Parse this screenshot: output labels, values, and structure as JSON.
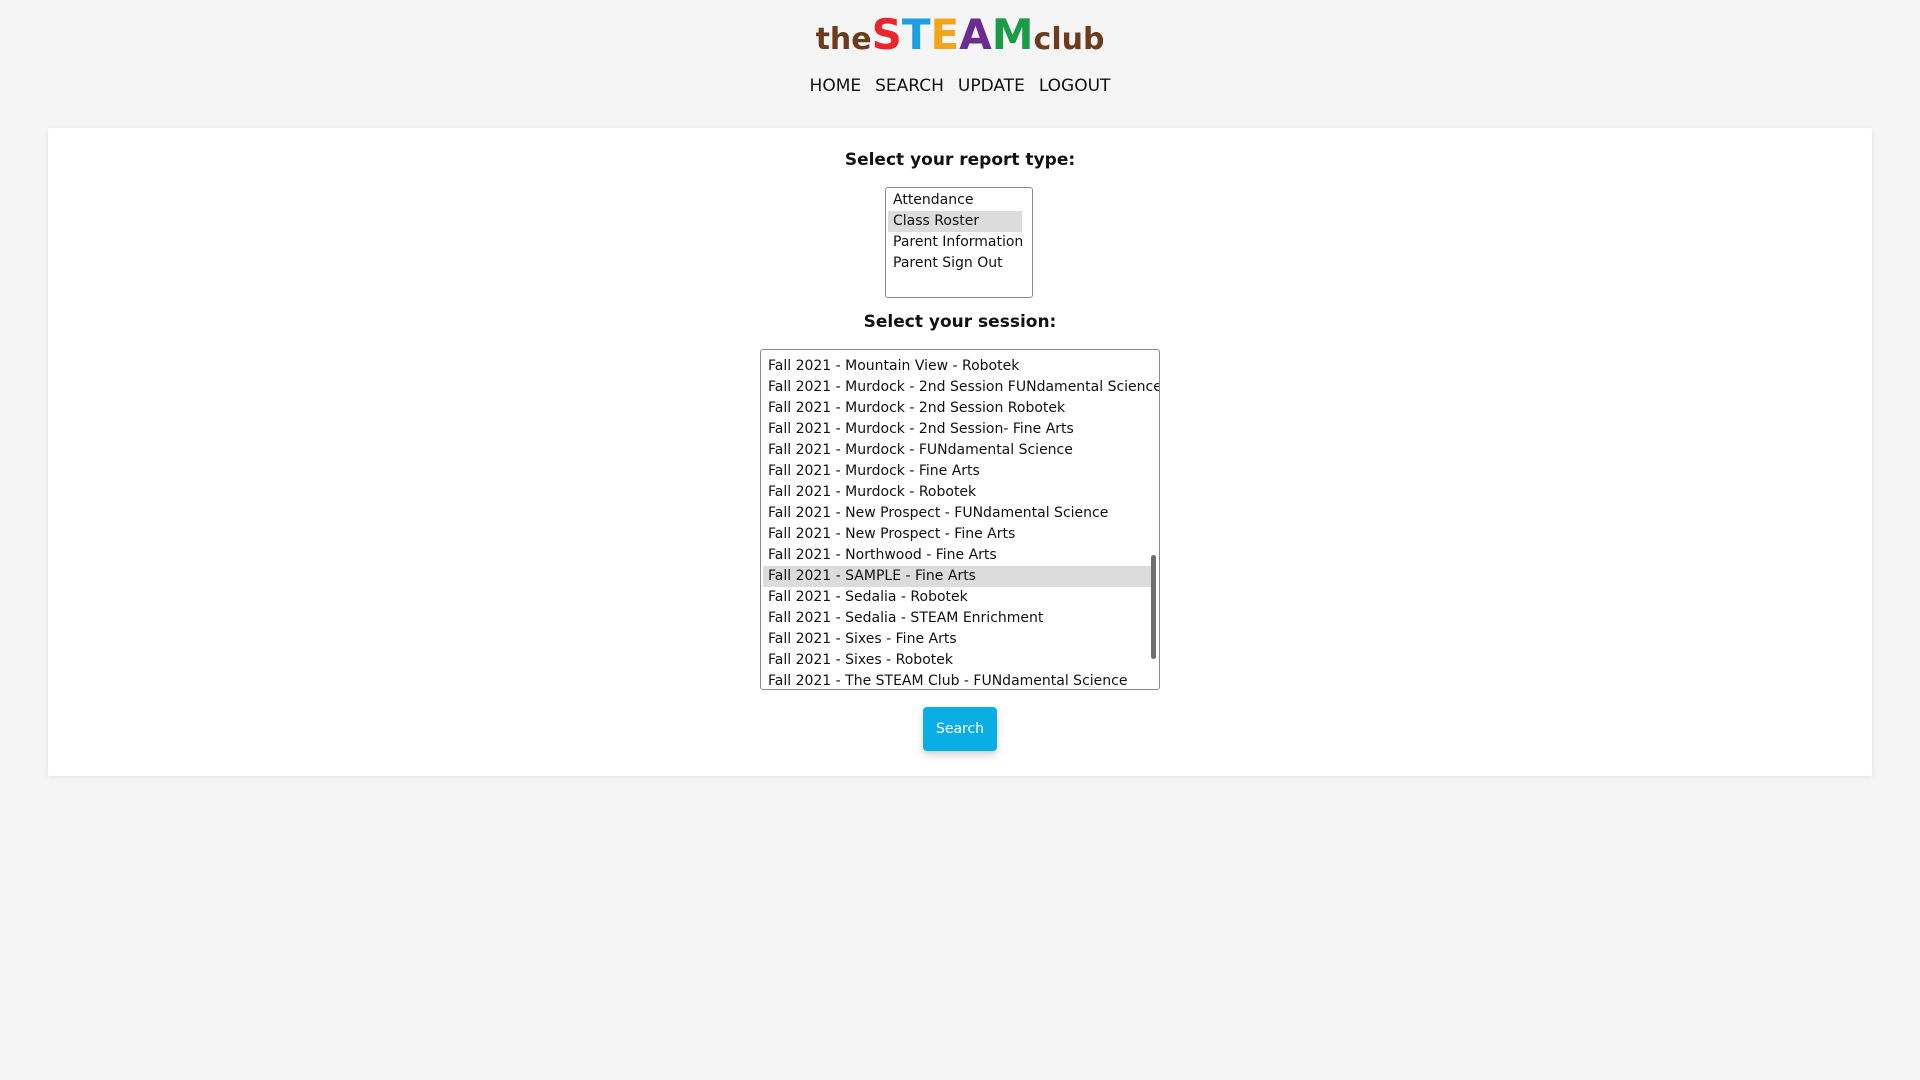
{
  "logo": {
    "prefix": "the",
    "letters": [
      {
        "char": "S",
        "color": "#e8262b"
      },
      {
        "char": "T",
        "color": "#1d9fe0"
      },
      {
        "char": "E",
        "color": "#f2a51a"
      },
      {
        "char": "A",
        "color": "#6a2c91"
      },
      {
        "char": "M",
        "color": "#1b9a4a"
      }
    ],
    "suffix": "club"
  },
  "nav": {
    "home": "HOME",
    "search": "SEARCH",
    "update": "UPDATE",
    "logout": "LOGOUT"
  },
  "report": {
    "label": "Select your report type:",
    "options": [
      "Attendance",
      "Class Roster",
      "Parent Information",
      "Parent Sign Out"
    ],
    "selected": "Class Roster"
  },
  "session": {
    "label": "Select your session:",
    "options": [
      "Fall 2021 - Mountain View - Robotek",
      "Fall 2021 - Murdock - 2nd Session FUNdamental Science",
      "Fall 2021 - Murdock - 2nd Session Robotek",
      "Fall 2021 - Murdock - 2nd Session- Fine Arts",
      "Fall 2021 - Murdock - FUNdamental Science",
      "Fall 2021 - Murdock - Fine Arts",
      "Fall 2021 - Murdock - Robotek",
      "Fall 2021 - New Prospect - FUNdamental Science",
      "Fall 2021 - New Prospect - Fine Arts",
      "Fall 2021 - Northwood - Fine Arts",
      "Fall 2021 - SAMPLE - Fine Arts",
      "Fall 2021 - Sedalia - Robotek",
      "Fall 2021 - Sedalia - STEAM Enrichment",
      "Fall 2021 - Sixes - Fine Arts",
      "Fall 2021 - Sixes - Robotek",
      "Fall 2021 - The STEAM Club - FUNdamental Science"
    ],
    "selected": "Fall 2021 - SAMPLE - Fine Arts"
  },
  "search_button": {
    "label": "Search",
    "color": "#0aaee5"
  }
}
